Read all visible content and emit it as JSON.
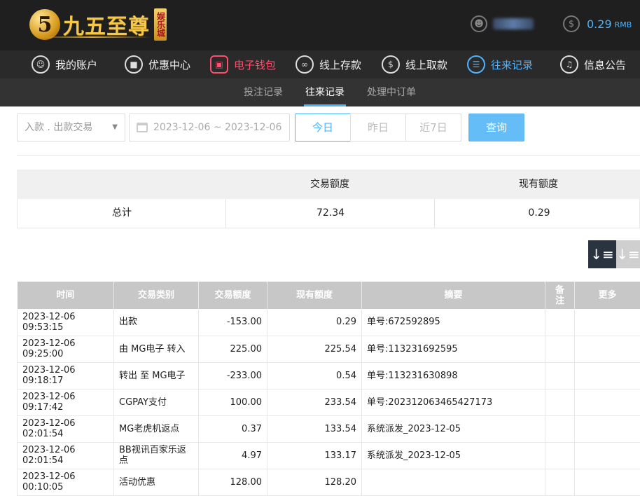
{
  "header": {
    "logo_numeral": "5",
    "logo_text": "九五至尊",
    "logo_badge": "娱乐城",
    "balance": "0.29",
    "balance_unit": "RMB"
  },
  "nav": [
    {
      "label": "我的账户",
      "icon": "user-icon"
    },
    {
      "label": "优惠中心",
      "icon": "gift-icon"
    },
    {
      "label": "电子钱包",
      "icon": "wallet-icon"
    },
    {
      "label": "线上存款",
      "icon": "deposit-icon"
    },
    {
      "label": "线上取款",
      "icon": "withdraw-icon"
    },
    {
      "label": "往来记录",
      "icon": "record-icon"
    },
    {
      "label": "信息公告",
      "icon": "bell-icon"
    }
  ],
  "subnav": [
    "投注记录",
    "往来记录",
    "处理中订单"
  ],
  "filter": {
    "type_value": "入款 . 出款交易",
    "date_range": "2023-12-06 ~ 2023-12-06",
    "day_buttons": [
      "今日",
      "昨日",
      "近7日"
    ],
    "query_label": "查询"
  },
  "summary": {
    "headers": [
      "",
      "交易额度",
      "现有额度"
    ],
    "row": [
      "总计",
      "72.34",
      "0.29"
    ]
  },
  "records": {
    "headers": [
      "时间",
      "交易类别",
      "交易额度",
      "现有额度",
      "摘要",
      "备注",
      "更多"
    ],
    "rows": [
      [
        "2023-12-06 09:53:15",
        "出款",
        "-153.00",
        "0.29",
        "单号:672592895",
        "",
        ""
      ],
      [
        "2023-12-06 09:25:00",
        "由 MG电子 转入",
        "225.00",
        "225.54",
        "单号:113231692595",
        "",
        ""
      ],
      [
        "2023-12-06 09:18:17",
        "转出 至 MG电子",
        "-233.00",
        "0.54",
        "单号:113231630898",
        "",
        ""
      ],
      [
        "2023-12-06 09:17:42",
        "CGPAY支付",
        "100.00",
        "233.54",
        "单号:202312063465427173",
        "",
        ""
      ],
      [
        "2023-12-06 02:01:54",
        "MG老虎机返点",
        "0.37",
        "133.54",
        "系统派发_2023-12-05",
        "",
        ""
      ],
      [
        "2023-12-06 02:01:54",
        "BB视讯百家乐返点",
        "4.97",
        "133.17",
        "系统派发_2023-12-05",
        "",
        ""
      ],
      [
        "2023-12-06 00:10:05",
        "活动优惠",
        "128.00",
        "128.20",
        "",
        "",
        ""
      ]
    ]
  }
}
